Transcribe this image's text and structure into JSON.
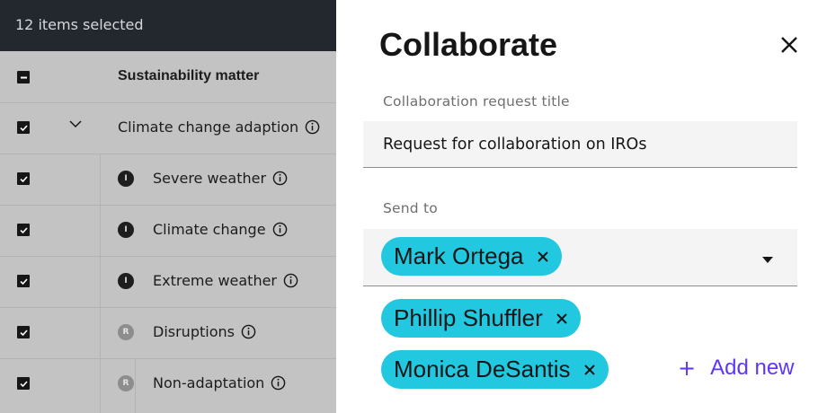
{
  "selection_bar": {
    "text": "12 items selected"
  },
  "table": {
    "header": {
      "label": "Sustainability matter"
    },
    "rows": [
      {
        "label": "Climate change adaption",
        "badge": "",
        "expanded": true
      },
      {
        "label": "Severe weather",
        "badge": "I"
      },
      {
        "label": "Climate change",
        "badge": "I"
      },
      {
        "label": "Extreme weather",
        "badge": "I"
      },
      {
        "label": "Disruptions",
        "badge": "R"
      },
      {
        "label": "Non-adaptation",
        "badge": "R"
      }
    ]
  },
  "modal": {
    "title": "Collaborate",
    "title_field": {
      "label": "Collaboration request title",
      "value": "Request for collaboration on IROs"
    },
    "send_to": {
      "label": "Send to",
      "recipients": [
        "Mark Ortega",
        "Phillip Shuffler",
        "Monica DeSantis"
      ]
    },
    "add_new": {
      "icon": "+",
      "label": "Add new"
    }
  },
  "colors": {
    "tag": "#22c7e0",
    "accent": "#5d35ff",
    "dark_bar": "#23272e"
  }
}
